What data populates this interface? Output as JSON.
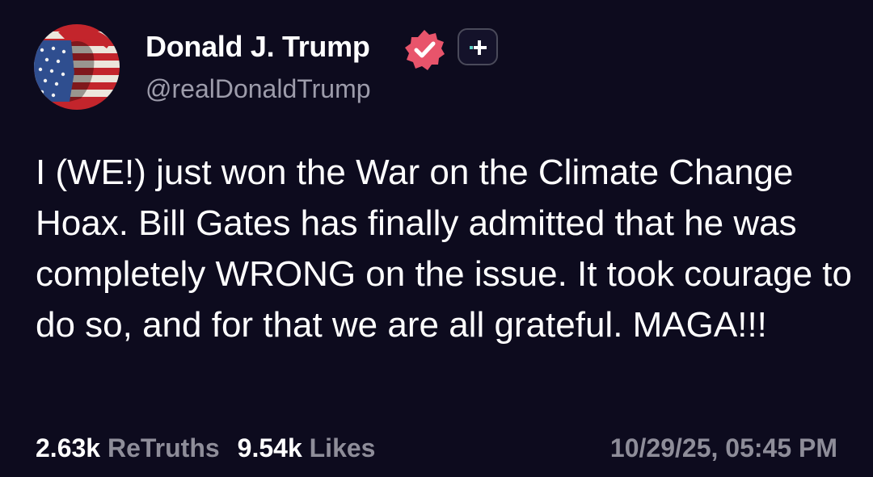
{
  "author": {
    "display_name": "Donald J. Trump",
    "handle": "@realDonaldTrump",
    "avatar_icon": "flag-face-avatar",
    "verified_icon": "verified-badge-icon",
    "follow_icon": "follow-plus-icon"
  },
  "post": {
    "text": "I (WE!) just won the War on the Climate Change Hoax. Bill Gates has finally admitted that he was completely WRONG on the issue. It took courage to do so, and for that we are all grateful. MAGA!!!"
  },
  "stats": {
    "retruths_count": "2.63k",
    "retruths_label": "ReTruths",
    "likes_count": "9.54k",
    "likes_label": "Likes"
  },
  "timestamp": "10/29/25, 05:45 PM",
  "colors": {
    "background": "#0d0b1e",
    "text": "#ffffff",
    "muted": "#8e8d99",
    "verified": "#e8546b",
    "follow_accent": "#5fd3c7"
  }
}
